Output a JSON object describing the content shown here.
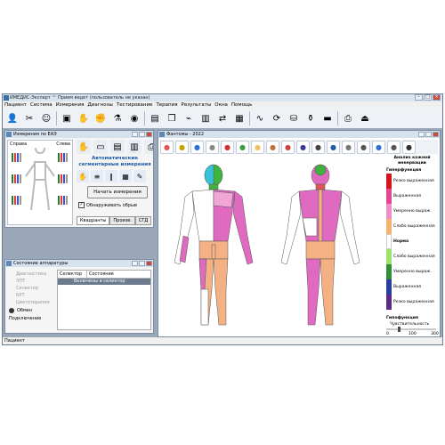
{
  "app": {
    "title": "ИМЕДИС-Эксперт ™ Прием ведет (пользователь не указан)",
    "menu": [
      "Пациент",
      "Система",
      "Измерения",
      "Диагнозы",
      "Тестирование",
      "Терапия",
      "Результаты",
      "Окна",
      "Помощь"
    ],
    "status": "Пациент"
  },
  "toolbar_icons": [
    "patient-icon",
    "tools-icon",
    "user-icon",
    "save-icon",
    "hand-icon",
    "glove-icon",
    "test-icon",
    "eye-icon",
    "card-icon",
    "copy-icon",
    "scan-icon",
    "chart-icon",
    "swap-icon",
    "grid-icon",
    "wave-icon",
    "sync-icon",
    "network-icon",
    "vial-icon",
    "bed-icon",
    "printer-icon",
    "exit-icon"
  ],
  "measure_window": {
    "title": "Измерения по ЕАЭ",
    "right_label": "Справа",
    "left_label": "Слева",
    "heading_line1": "Автоматические",
    "heading_line2": "сегментарные измерения",
    "start_button": "Начать измерения",
    "checkbox_label": "Обнаруживать обрыв",
    "tabs": [
      "Квадранты",
      "Произв.",
      "СГД"
    ]
  },
  "equipment_window": {
    "title": "Состояние аппаратуры",
    "items": [
      "Диагностика",
      "ЭПТ",
      "Селектор",
      "БРТ",
      "Цветотерапия"
    ],
    "exchange_label": "Обмен",
    "connect_label": "Подключение",
    "table_headers": [
      "Селектор",
      "Состояние"
    ],
    "table_row": "Включены в селектор"
  },
  "phantom_window": {
    "title": "Фантомы - 2022",
    "legend": {
      "heading_line1": "Анализ кожной",
      "heading_line2": "иннервации",
      "hyper": "Гиперфункция",
      "norm": "Норма",
      "hypo": "Гипофункция",
      "levels": [
        {
          "label": "Резко выраженная",
          "color": "#d5151e"
        },
        {
          "label": "Выраженная",
          "color": "#e3478f"
        },
        {
          "label": "Умеренно выраж.",
          "color": "#ee8ec7"
        },
        {
          "label": "Слабо выраженная",
          "color": "#f5b26e"
        },
        {
          "label": "Норма",
          "color": "#ffffff"
        },
        {
          "label": "Слабо выраженная",
          "color": "#9ee36e"
        },
        {
          "label": "Умеренно выраж.",
          "color": "#2f8f3a"
        },
        {
          "label": "Выраженная",
          "color": "#2a3f9f"
        },
        {
          "label": "Резко выраженная",
          "color": "#5b2b86"
        }
      ],
      "sensitivity_label": "Чувствительность",
      "sensitivity_value": 0.25,
      "scale": [
        "0",
        "100",
        "300"
      ]
    }
  },
  "colors": {
    "pink": "#e06ac0",
    "orange": "#f4b183",
    "cyan": "#36c3d8",
    "green": "#3fb23f",
    "lime": "#a8e07b",
    "red": "#e25555"
  }
}
